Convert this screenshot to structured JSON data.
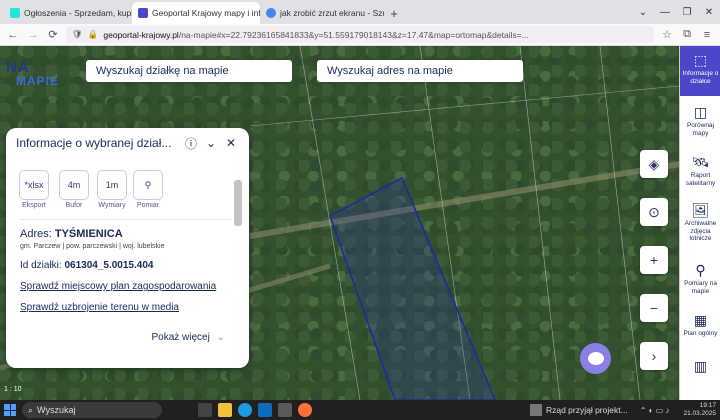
{
  "browser": {
    "tabs": [
      {
        "label": "Ogłoszenia - Sprzedam, kupię i...",
        "active": false,
        "favicon_color": "#23e5db"
      },
      {
        "label": "Geoportal Krajowy mapy i info...",
        "active": true,
        "favicon_color": "#4a47c9"
      },
      {
        "label": "jak zrobić zrzut ekranu - Szuka...",
        "active": false,
        "favicon_color": "#4285f4"
      }
    ],
    "new_tab": "+",
    "window_controls": [
      "⌄",
      "—",
      "❐",
      "✕"
    ],
    "url_host": "geoportal-krajowy.pl",
    "url_rest": "/na-mapie#x=22.79236165841833&y=51.559179018143&z=17.47&map=ortomap&details=..."
  },
  "map": {
    "logo": {
      "top": "NA",
      "bottom": "MAPIE"
    },
    "search_parcel": "Wyszukaj działkę na mapie",
    "search_address": "Wyszukaj adres na mapie",
    "scale_label": "1 : 10"
  },
  "panel": {
    "title": "Informacje o wybranej dział...",
    "tools": [
      {
        "icon": "*xlsx",
        "label": "Eksport"
      },
      {
        "icon": "4m",
        "label": "Bufor"
      },
      {
        "icon": "1m",
        "label": "Wymiary"
      },
      {
        "icon": "⚲",
        "label": "Pomiar"
      }
    ],
    "address_label": "Adres:",
    "address_value": "TYŚMIENICA",
    "address_detail": "gm. Parczew | pow. parczewski | woj. lubelskie",
    "id_label": "Id działki:",
    "id_value": "061304_5.0015.404",
    "link_plan": "Sprawdź miejscowy plan zagospodarowania",
    "link_media": "Sprawdź uzbrojenie terenu w media",
    "more": "Pokaż więcej"
  },
  "sidebar": [
    {
      "label": "Informacje o działce",
      "active": true
    },
    {
      "label": "Porównaj mapy",
      "active": false
    },
    {
      "label": "Raport satelitarny",
      "active": false
    },
    {
      "label": "Archiwalne zdjęcia lotnicze",
      "active": false
    },
    {
      "label": "Pomiary na mapie",
      "active": false
    },
    {
      "label": "Plan ogólny",
      "active": false
    },
    {
      "label": "",
      "active": false
    }
  ],
  "taskbar": {
    "search_placeholder": "Wyszukaj",
    "notification": "Rząd przyjął projekt...",
    "time": "19:17",
    "date": "21.03.2025"
  },
  "colors": {
    "accent": "#4a47c9",
    "parcel_outline": "#1f2aa0",
    "panel_text": "#1a2a5a"
  }
}
